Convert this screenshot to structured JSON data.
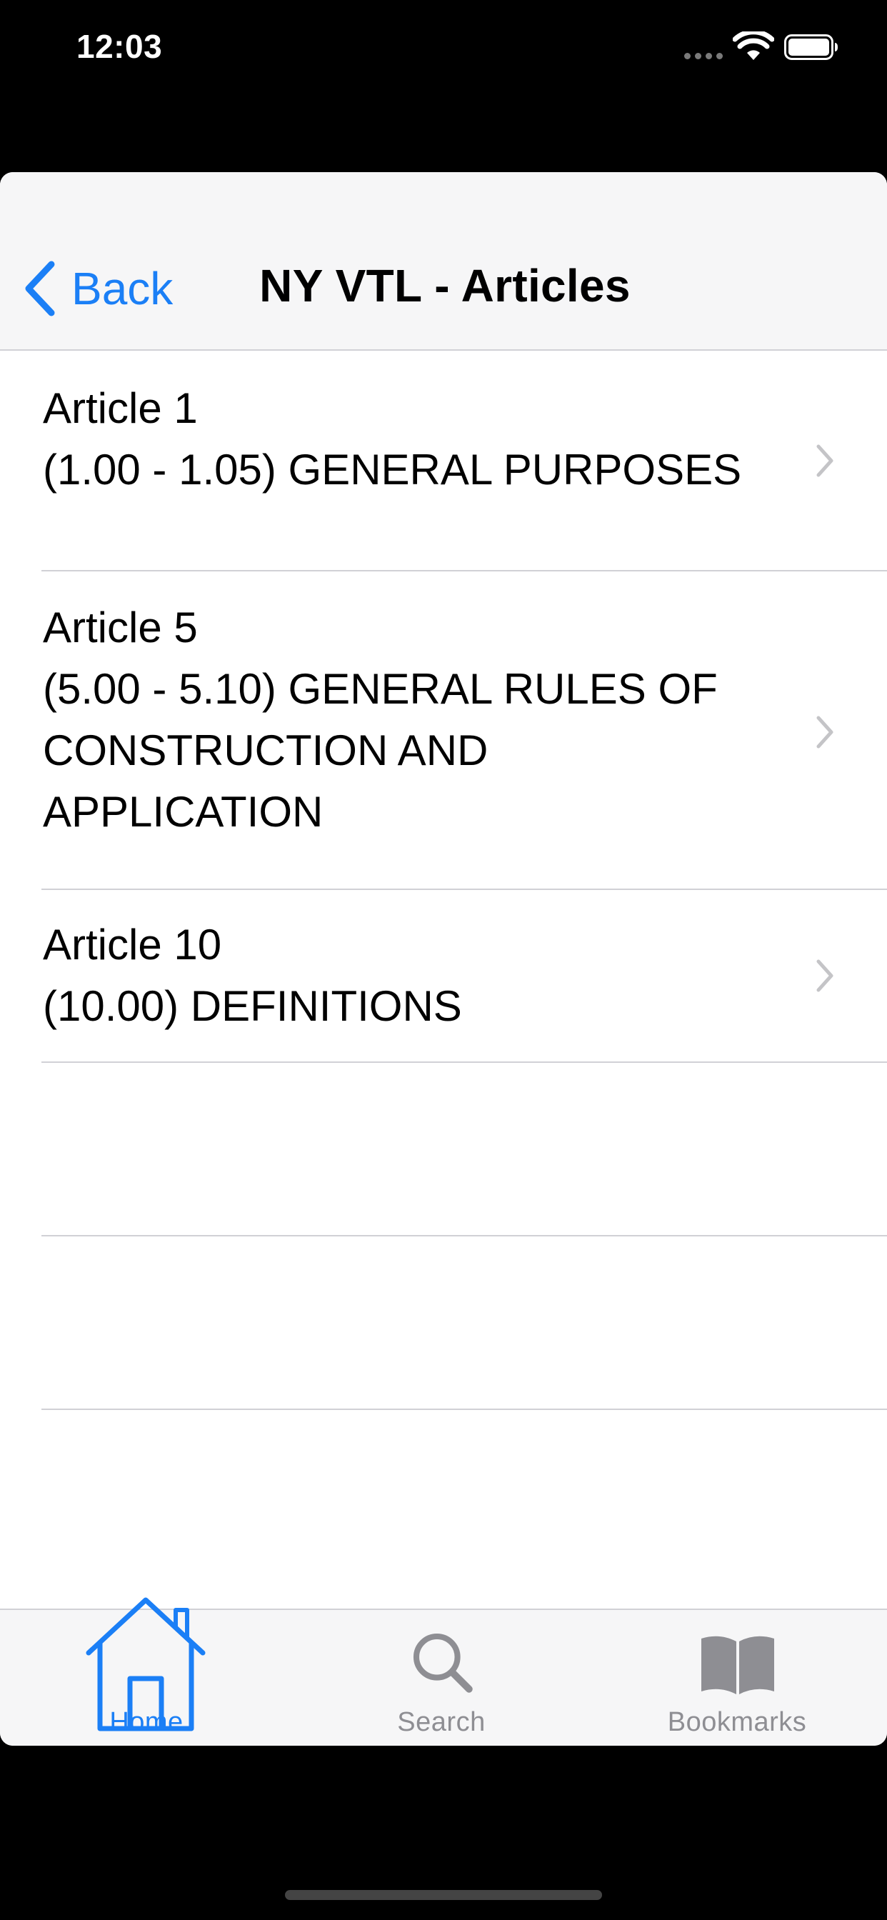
{
  "status_bar": {
    "time": "12:03"
  },
  "nav_bar": {
    "back_label": "Back",
    "title": "NY VTL - Articles"
  },
  "articles": [
    {
      "title": "Article 1",
      "description_lines": [
        "(1.00 - 1.05) GENERAL PURPOSES"
      ]
    },
    {
      "title": "Article 5",
      "description_lines": [
        "(5.00 - 5.10) GENERAL RULES OF",
        "CONSTRUCTION AND",
        "APPLICATION"
      ]
    },
    {
      "title": "Article 10",
      "description_lines": [
        "(10.00) DEFINITIONS"
      ]
    }
  ],
  "tab_bar": {
    "tabs": [
      {
        "label": "Home",
        "icon": "home-icon",
        "active": true
      },
      {
        "label": "Search",
        "icon": "search-icon",
        "active": false
      },
      {
        "label": "Bookmarks",
        "icon": "bookmarks-icon",
        "active": false
      }
    ]
  },
  "colors": {
    "accent": "#1b7ff6",
    "inactive": "#8e8e93",
    "separator": "#d1d1d6",
    "bar_background": "#f6f6f7"
  }
}
